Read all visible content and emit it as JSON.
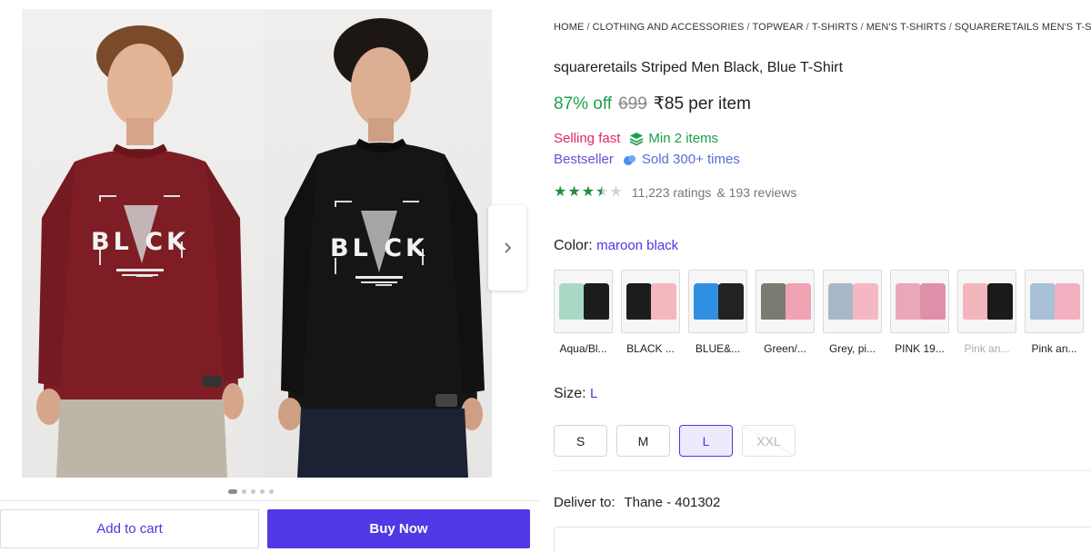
{
  "gallery": {
    "shirt_print_1": "BL CK",
    "shirt_print_2": "BL CK",
    "next_icon": "chevron-right-icon",
    "dot_count": 5,
    "active_dot": 0
  },
  "actions": {
    "add_to_cart": "Add to cart",
    "buy_now": "Buy Now"
  },
  "breadcrumb": [
    "HOME",
    "CLOTHING AND ACCESSORIES",
    "TOPWEAR",
    "T-SHIRTS",
    "MEN'S T-SHIRTS",
    "SQUARERETAILS MEN'S T-SHIRTS"
  ],
  "product": {
    "title": "squareretails Striped Men Black, Blue T-Shirt",
    "discount": "87% off",
    "mrp": "699",
    "price": "₹85 per item",
    "selling_fast": "Selling fast",
    "min_items": "Min 2 items",
    "bestseller": "Bestseller",
    "sold_times": "Sold 300+ times",
    "rating_value": 3.5,
    "ratings_count": "11,223 ratings",
    "reviews_count": "& 193 reviews"
  },
  "color": {
    "label": "Color:",
    "selected": "maroon black",
    "variants": [
      {
        "label": "Aqua/Bl...",
        "c1": "#a9d9c4",
        "c2": "#1c1c1c",
        "available": true
      },
      {
        "label": "BLACK ...",
        "c1": "#1c1c1c",
        "c2": "#f4b6bf",
        "available": true
      },
      {
        "label": "BLUE&...",
        "c1": "#2f8fe0",
        "c2": "#222222",
        "available": true
      },
      {
        "label": "Green/...",
        "c1": "#7a7a70",
        "c2": "#f0a3b3",
        "available": true
      },
      {
        "label": "Grey, pi...",
        "c1": "#a8b8c8",
        "c2": "#f4b8c4",
        "available": true
      },
      {
        "label": "PINK 19...",
        "c1": "#e8a8b8",
        "c2": "#e08fa8",
        "available": true
      },
      {
        "label": "Pink an...",
        "c1": "#f3b6bd",
        "c2": "#1a1a1a",
        "available": false
      },
      {
        "label": "Pink an...",
        "c1": "#a8c0d8",
        "c2": "#f2b0c0",
        "available": true
      }
    ]
  },
  "size": {
    "label": "Size:",
    "selected": "L",
    "options": [
      {
        "label": "S",
        "state": "normal"
      },
      {
        "label": "M",
        "state": "normal"
      },
      {
        "label": "L",
        "state": "selected"
      },
      {
        "label": "XXL",
        "state": "disabled"
      }
    ]
  },
  "delivery": {
    "label": "Deliver to:",
    "location": "Thane - 401302"
  },
  "colors": {
    "accent": "#5139e6",
    "discount_green": "#1ea049",
    "selling_fast_pink": "#e02a61",
    "star_green": "#1e8f3d"
  }
}
